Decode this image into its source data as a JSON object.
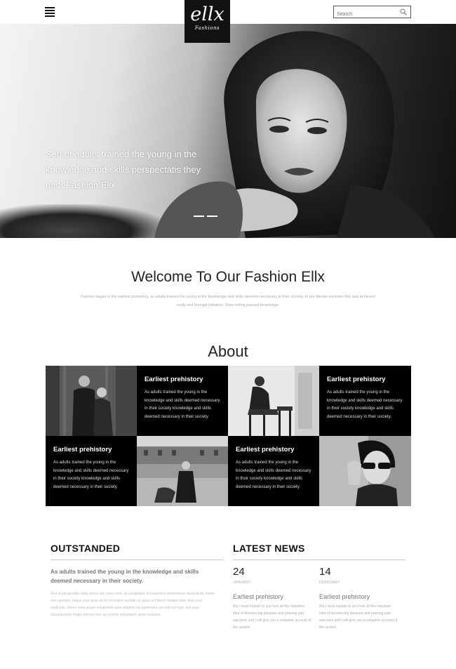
{
  "header": {
    "logo_main": "ellx",
    "logo_sub": "Fashions",
    "search_placeholder": "Search"
  },
  "hero": {
    "text": "Sed ut adults trained the young in the knowledge and skills perspectatis they undeFashion Ellx"
  },
  "welcome": {
    "title": "Welcome To Our Fashion Ellx",
    "text": "Fashion began in the earliest prehistory, as adults trained the young in the knowledge and skills deemed necessary in their society. In pre-literate societies this was achieved orally and through imitation. Story-telling passed knowledge."
  },
  "about": {
    "title": "About",
    "tiles": [
      {
        "heading": "Earliest prehistory",
        "text": "As adults trained the young in the knowledge and skills deemed necessary in their society knowledge and skills deemed necessary in their society."
      },
      {
        "heading": "Earliest prehistory",
        "text": "As adults trained the young in the knowledge and skills deemed necessary in their society knowledge and skills deemed necessary in their society."
      },
      {
        "heading": "Earliest prehistory",
        "text": "As adults trained the young in the knowledge and skills deemed necessary in their society knowledge and skills deemed necessary in their society."
      },
      {
        "heading": "Earliest prehistory",
        "text": "As adults trained the young in the knowledge and skills deemed necessary in their society knowledge and skills deemed necessary in their society."
      }
    ]
  },
  "outstanded": {
    "title": "OUTSTANDED",
    "lead": "As adults trained the young in the knowledge and skills deemed necessary in their society.",
    "body": "Sed ut perspiciatis unde omnis iste natus error sit voluptatem accusantium doloremque laudantium, totam rem aperiam, eaque ipsa quae ab illo inventore veritatis et quasi architecto beatae vitae dicta sunt explicabo. Nemo enim ipsam voluptatem quia voluptas sit aspernatur aut odit aut fugit, sed quia consequuntur magni dolores eos qui ratione voluptatem sequi nesciunt."
  },
  "news": {
    "title": "LATEST NEWS",
    "items": [
      {
        "day": "24",
        "month": "JANUARY",
        "title": "Earliest prehistory",
        "excerpt": "But I must explain to you how all this mistaken idea of denouncing pleasure and praising pain was born and I will give you a complete account of the system"
      },
      {
        "day": "14",
        "month": "FEBRUARY",
        "title": "Earliest prehistory",
        "excerpt": "But I must explain to you how all this mistaken idea of denouncing pleasure and praising pain was born and I will give you a complete account of the system"
      }
    ]
  },
  "colors": {
    "dark": "#000000",
    "text": "#222222",
    "muted": "#aaaaaa"
  }
}
